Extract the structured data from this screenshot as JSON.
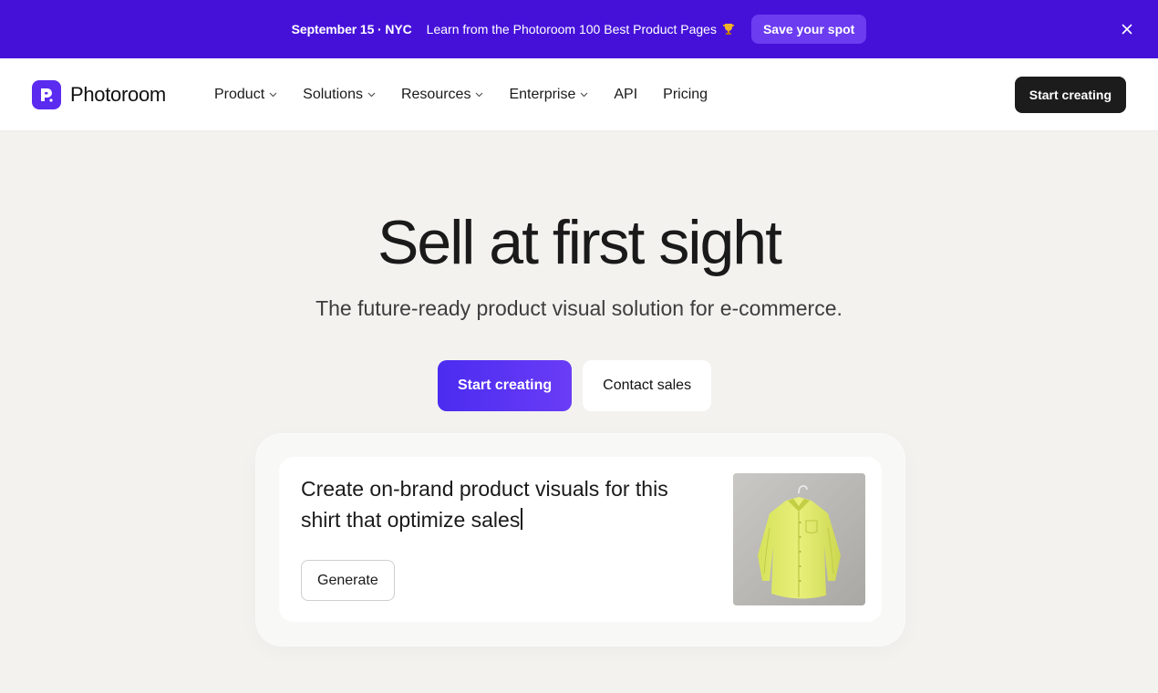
{
  "banner": {
    "date": "September 15 · NYC",
    "text": "Learn from the Photoroom 100 Best Product Pages",
    "cta_label": "Save your spot",
    "icon": "trophy-icon",
    "close_icon": "close-icon",
    "background_color": "#4511d9"
  },
  "header": {
    "logo_text": "Photoroom",
    "nav": [
      {
        "label": "Product",
        "has_dropdown": true
      },
      {
        "label": "Solutions",
        "has_dropdown": true
      },
      {
        "label": "Resources",
        "has_dropdown": true
      },
      {
        "label": "Enterprise",
        "has_dropdown": true
      },
      {
        "label": "API",
        "has_dropdown": false
      },
      {
        "label": "Pricing",
        "has_dropdown": false
      }
    ],
    "cta_label": "Start creating"
  },
  "hero": {
    "title": "Sell at first sight",
    "subtitle": "The future-ready product visual solution for e-commerce.",
    "primary_cta": "Start creating",
    "secondary_cta": "Contact sales",
    "accent_color": "#4b2cf0"
  },
  "prompt": {
    "text": "Create on-brand product visuals for this shirt that optimize sales",
    "generate_label": "Generate",
    "image_subject": "yellow-shirt-on-hanger"
  }
}
